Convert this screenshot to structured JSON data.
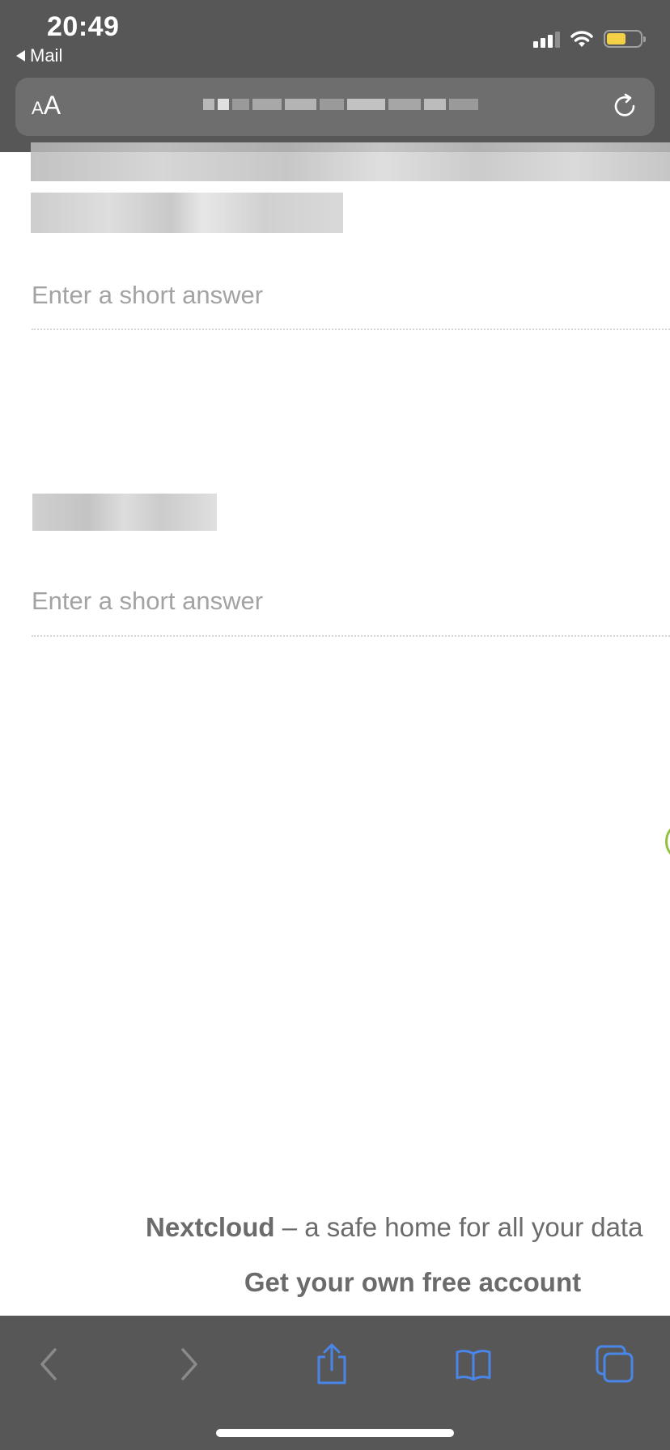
{
  "status_bar": {
    "time": "20:49",
    "back_app_label": "Mail"
  },
  "address_bar": {
    "aa_small": "A",
    "aa_large": "A"
  },
  "form": {
    "answer_1_placeholder": "Enter a short answer",
    "answer_2_placeholder": "Enter a short answer"
  },
  "footer": {
    "brand": "Nextcloud",
    "tagline": " – a safe home for all your data",
    "cta": "Get your own free account"
  },
  "colors": {
    "chrome_bg": "#575757",
    "url_bar_bg": "#6e6e6e",
    "toolbar_icon_active": "#4a86e8",
    "toolbar_icon_disabled": "#8a8a8a",
    "battery_fill": "#f4d046"
  },
  "icons": {
    "back": "chevron-left-icon",
    "forward": "chevron-right-icon",
    "share": "share-icon",
    "bookmarks": "book-icon",
    "tabs": "tabs-icon",
    "reload": "reload-icon",
    "signal": "signal-icon",
    "wifi": "wifi-icon",
    "battery": "battery-icon"
  }
}
